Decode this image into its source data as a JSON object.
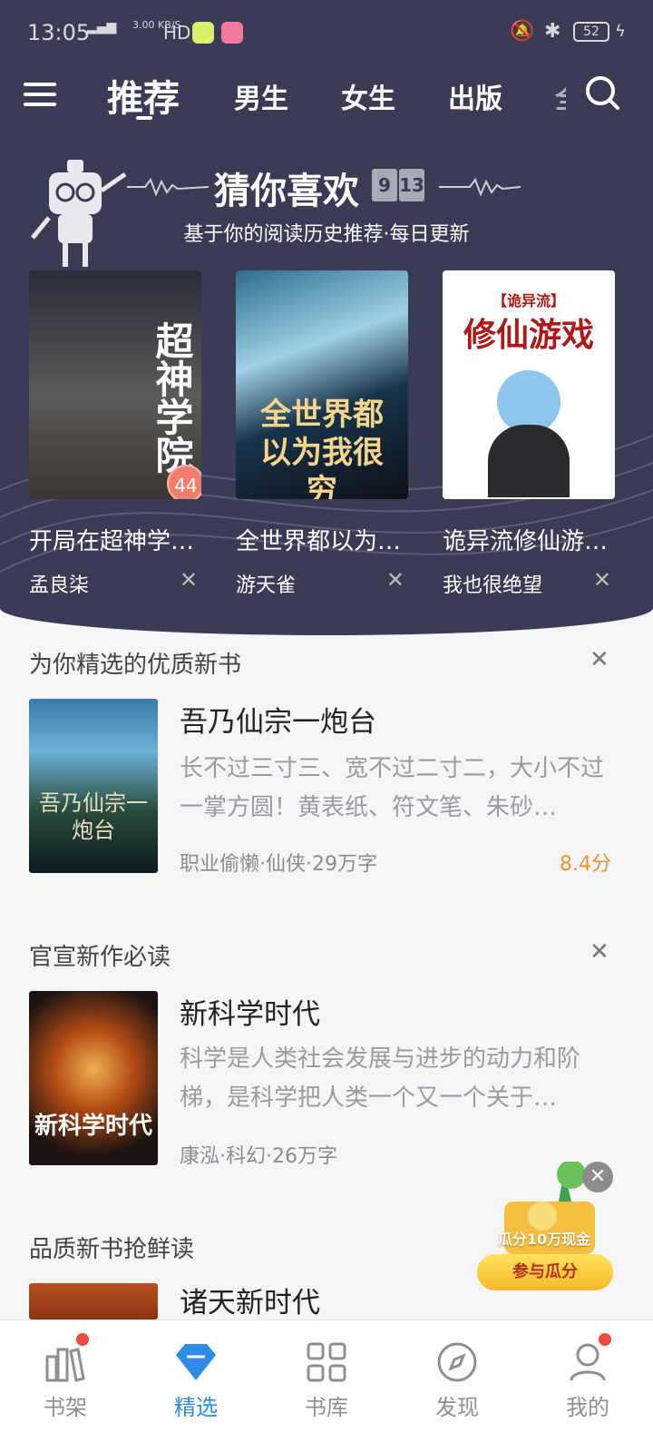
{
  "status_bar": {
    "time": "13:05",
    "signal": "46 ⁴ᴳ",
    "speed": "3.00 KB/S",
    "hd": "HD",
    "battery": "52"
  },
  "top_nav": {
    "tabs": [
      "推荐",
      "男生",
      "女生",
      "出版",
      "..."
    ]
  },
  "hero": {
    "title": "猜你喜欢",
    "flip_digits": [
      "9",
      "13"
    ],
    "subtitle": "基于你的阅读历史推荐·每日更新",
    "books": [
      {
        "name": "开局在超神学…",
        "author": "孟良柒",
        "cover_text": "超神学院",
        "badge": "44"
      },
      {
        "name": "全世界都以为…",
        "author": "游天雀",
        "cover_text": "全世界都以为我很穷"
      },
      {
        "name": "诡异流修仙游…",
        "author": "我也很绝望",
        "cover_text": "修仙游戏",
        "cover_tag": "【诡异流】"
      }
    ]
  },
  "sections": [
    {
      "title": "为你精选的优质新书",
      "book": {
        "title": "吾乃仙宗一炮台",
        "desc": "长不过三寸三、宽不过二寸二，大小不过一掌方圆！黄表纸、符文笔、朱砂…",
        "meta": "职业偷懒·仙侠·29万字",
        "score": "8.4分",
        "cover_text": "吾乃仙宗一炮台"
      }
    },
    {
      "title": "官宣新作必读",
      "book": {
        "title": "新科学时代",
        "desc": "科学是人类社会发展与进步的动力和阶梯，是科学把人类一个又一个关于…",
        "meta": "康泓·科幻·26万字",
        "cover_text": "新科学时代"
      }
    },
    {
      "title": "品质新书抢鲜读",
      "book": {
        "title": "诸天新时代"
      }
    }
  ],
  "promo": {
    "line1": "瓜分10万现金",
    "line2": "参与瓜分"
  },
  "tab_bar": [
    {
      "label": "书架",
      "icon": "bookshelf-icon",
      "dot": true
    },
    {
      "label": "精选",
      "icon": "diamond-icon",
      "active": true
    },
    {
      "label": "书库",
      "icon": "grid-icon"
    },
    {
      "label": "发现",
      "icon": "compass-icon"
    },
    {
      "label": "我的",
      "icon": "user-icon",
      "dot": true
    }
  ],
  "colors": {
    "hero_bg": "#3a3b55",
    "accent": "#2e8be8",
    "score": "#f0902e",
    "badge": "#f07d6e"
  }
}
